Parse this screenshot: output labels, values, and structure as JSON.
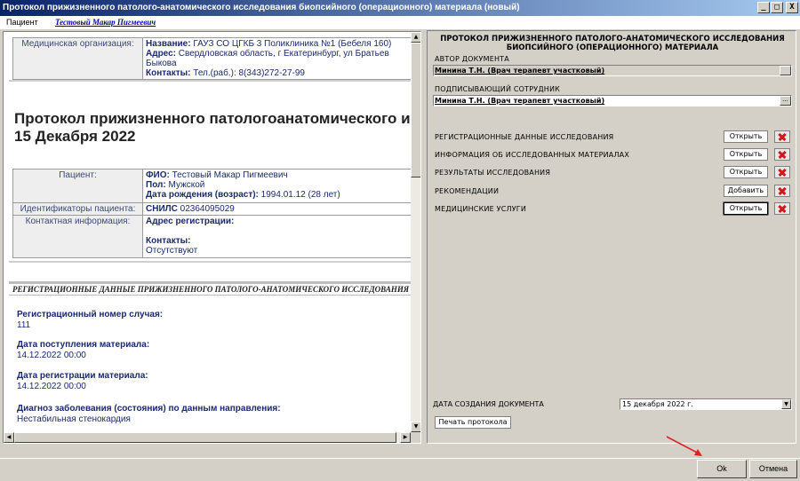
{
  "window": {
    "title": "Протокол прижизненного патолого-анатомического исследования биопсийного (операционного) материала (новый)",
    "btn_min": "_",
    "btn_max": "□",
    "btn_close": "X"
  },
  "menu": {
    "patient_label": "Пациент",
    "patient_name": "Тестовый Макар Пигмеевич"
  },
  "document": {
    "org": {
      "label": "Медицинская организация:",
      "name_key": "Название:",
      "name_val": "ГАУЗ СО ЦГКБ 3 Поликлиника №1 (Бебеля 160)",
      "addr_key": "Адрес:",
      "addr_val": "Свердловская область, г Екатеринбург, ул Братьев Быкова",
      "contacts_key": "Контакты:",
      "contacts_val": "Тел.(раб.): 8(343)272-27-99"
    },
    "heading_line1": "Протокол прижизненного патологоанатомического исследования",
    "heading_line2": "15 Декабря 2022",
    "patient": {
      "label": "Пациент:",
      "fio_key": "ФИО:",
      "fio_val": "Тестовый Макар Пигмеевич",
      "sex_key": "Пол:",
      "sex_val": "Мужской",
      "dob_key": "Дата рождения (возраст):",
      "dob_val": "1994.01.12 (28 лет)",
      "ids_label": "Идентификаторы пациента:",
      "snils_key": "СНИЛС",
      "snils_val": "02364095029",
      "contact_label": "Контактная информация:",
      "reg_addr_key": "Адрес регистрации:",
      "contacts_key": "Контакты:",
      "contacts_val": "Отсутствуют"
    },
    "section_title": "РЕГИСТРАЦИОННЫЕ ДАННЫЕ ПРИЖИЗНЕННОГО ПАТОЛОГО-АНАТОМИЧЕСКОГО ИССЛЕДОВАНИЯ",
    "fields": [
      {
        "label": "Регистрационный номер случая:",
        "value": "111"
      },
      {
        "label": "Дата поступления материала:",
        "value": "14.12.2022 00:00"
      },
      {
        "label": "Дата регистрации материала:",
        "value": "14.12.2022 00:00"
      },
      {
        "label": "Диагноз заболевания (состояния) по данным направления:",
        "value": "Нестабильная стенокардия"
      }
    ]
  },
  "panel": {
    "title_line1": "ПРОТОКОЛ ПРИЖИЗНЕННОГО ПАТОЛОГО-АНАТОМИЧЕСКОГО ИССЛЕДОВАНИЯ",
    "title_line2": "БИОПСИЙНОГО (ОПЕРАЦИОННОГО) МАТЕРИАЛА",
    "author_label": "АВТОР ДОКУМЕНТА",
    "author_value": "Минина Т.Н. (Врач терапевт участковый)",
    "signer_label": "ПОДПИСЫВАЮЩИЙ СОТРУДНИК",
    "signer_value": "Минина Т.Н. (Врач терапевт участковый)",
    "combo_btn": "...",
    "rows": [
      {
        "label": "РЕГИСТРАЦИОННЫЕ ДАННЫЕ ИССЛЕДОВАНИЯ",
        "button": "Открыть"
      },
      {
        "label": "ИНФОРМАЦИЯ ОБ ИССЛЕДОВАННЫХ МАТЕРИАЛАХ",
        "button": "Открыть"
      },
      {
        "label": "РЕЗУЛЬТАТЫ ИССЛЕДОВАНИЯ",
        "button": "Открыть"
      },
      {
        "label": "РЕКОМЕНДАЦИИ",
        "button": "Добавить"
      },
      {
        "label": "МЕДИЦИНСКИЕ УСЛУГИ",
        "button": "Открыть"
      }
    ],
    "date_label": "ДАТА СОЗДАНИЯ ДОКУМЕНТА",
    "date_value": "15  декабря  2022 г.",
    "date_btn": "▼",
    "print_button": "Печать протокола"
  },
  "footer": {
    "ok": "Ok",
    "cancel": "Отмена"
  },
  "colors": {
    "annotation_arrow": "#e02020"
  }
}
